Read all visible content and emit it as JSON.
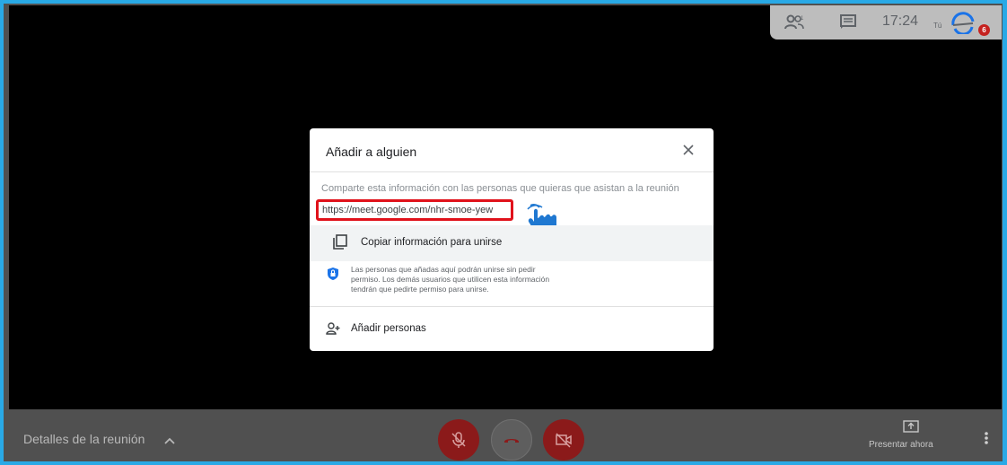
{
  "topbar": {
    "people_icon": "people-icon",
    "chat_icon": "chat-icon",
    "time": "17:24",
    "self_label": "Tú",
    "avatar_icon": "avatar-icon",
    "badge_count": "6"
  },
  "dialog": {
    "title": "Añadir a alguien",
    "close_icon": "close-icon",
    "share_text": "Comparte esta información con las personas que quieras que asistan a la reunión",
    "meeting_url": "https://meet.google.com/nhr-smoe-yew",
    "copy_label": "Copiar información para unirse",
    "note_lines": [
      "Las personas que añadas aquí podrán unirse sin pedir",
      "permiso. Los demás usuarios que utilicen esta información",
      "tendrán que pedirte permiso para unirse."
    ],
    "add_people_label": "Añadir personas"
  },
  "bottombar": {
    "details_label": "Detalles de la reunión",
    "present_label": "Presentar ahora"
  },
  "colors": {
    "frame_border": "#29a9e6",
    "highlight": "#e0121b",
    "hand": "#1f78d1",
    "control_red": "#8b1a1a"
  }
}
